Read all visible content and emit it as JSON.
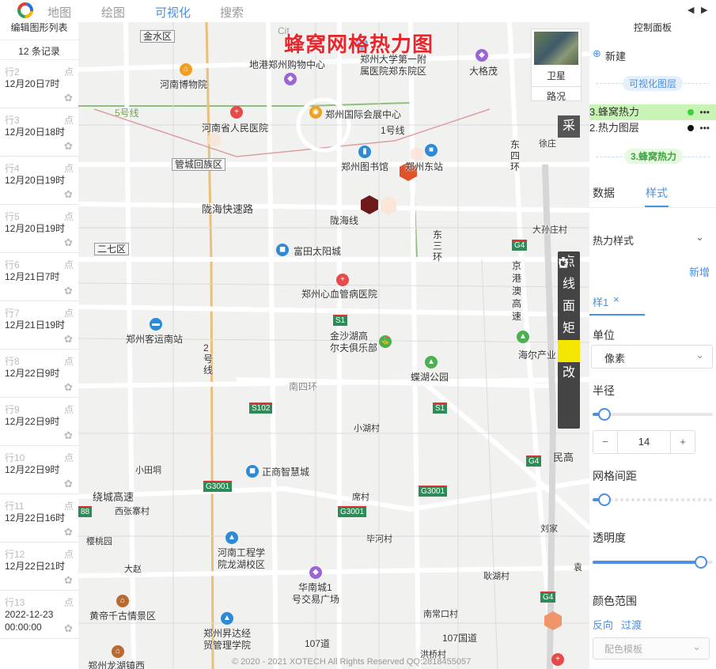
{
  "topbar": {
    "tabs": [
      {
        "label": "地图"
      },
      {
        "label": "绘图"
      },
      {
        "label": "可视化"
      },
      {
        "label": "搜索"
      }
    ]
  },
  "left": {
    "title": "编辑图形列表",
    "count": "12 条记录",
    "rows": [
      {
        "id": "行2",
        "point": "点",
        "time": "12月20日7时"
      },
      {
        "id": "行3",
        "point": "点",
        "time": "12月20日18时"
      },
      {
        "id": "行4",
        "point": "点",
        "time": "12月20日19时"
      },
      {
        "id": "行5",
        "point": "点",
        "time": "12月20日19时"
      },
      {
        "id": "行6",
        "point": "点",
        "time": "12月21日7时"
      },
      {
        "id": "行7",
        "point": "点",
        "time": "12月21日19时"
      },
      {
        "id": "行8",
        "point": "点",
        "time": "12月22日9时"
      },
      {
        "id": "行9",
        "point": "点",
        "time": "12月22日9时"
      },
      {
        "id": "行10",
        "point": "点",
        "time": "12月22日9时"
      },
      {
        "id": "行11",
        "point": "点",
        "time": "12月22日16时"
      },
      {
        "id": "行12",
        "point": "点",
        "time": "12月22日21时"
      },
      {
        "id": "行13",
        "point": "点",
        "time": "2022-12-23\n00:00:00"
      }
    ]
  },
  "map": {
    "title": "蜂窝网格热力图",
    "satellite_label": "卫星",
    "road_label": "路况",
    "cai_label": "采",
    "tools": [
      "点",
      "线",
      "面",
      "矩",
      "▤",
      "改",
      "🗑",
      "⏻"
    ],
    "copyright": "© 2020 - 2021 XOTECH All Rights Reserved QQ:2818455057",
    "labels": {
      "jinshui": "金水区",
      "dixun": "地港郑州购物中心",
      "henan_museum": "河南博物院",
      "zhengda": "郑州大学第一附",
      "zhengda2": "属医院郑东院区",
      "dageyu": "大格茂",
      "expo": "郑州国际会展中心",
      "hospital": "河南省人民医院",
      "library": "郑州图书馆",
      "east_station": "郑州东站",
      "guancheng": "管城回族区",
      "longhai": "陇海快速路",
      "longhai2": "陇海线",
      "erqi": "二七区",
      "futian": "富田太阳城",
      "heart": "郑州心血管病医院",
      "coach": "郑州客运南站",
      "golf": "金沙湖高",
      "golf2": "尔夫俱乐部",
      "dieshu": "蝶湖公园",
      "haier": "海尔产业",
      "xiaohu": "小湖村",
      "zhengshang": "正商智慧城",
      "xiaoyin": "小田垌",
      "xinan": "西张寨村",
      "raocheng": "绕城高速",
      "yingtao": "樱桃园",
      "henan_eng": "河南工程学",
      "henan_eng2": "院龙湖校区",
      "huanan": "华南城1",
      "huanan2": "号交易广场",
      "dazhao": "大赵",
      "huangdi": "黄帝千古情景区",
      "shengda": "郑州昇达经",
      "shengda2": "贸管理学院",
      "longhu": "郑州龙湖镇西",
      "xizhuang": "席村",
      "bihe": "毕河村",
      "nanchang": "南常口村",
      "hongqiao": "洪桥村",
      "dadahuang": "大孙庄村",
      "xulao": "徐庄",
      "liujia": "刘家",
      "ruiwang": "耿湖村",
      "yuan": "袁",
      "east4": "东四环",
      "east3": "东三环",
      "jinggang": "京港澳高速",
      "south4": "南四环",
      "line107": "107道",
      "line107b": "107国道",
      "line2": "2号线",
      "line1": "1号线",
      "line5": "5号线",
      "minggao": "民高",
      "cit": "Cit"
    },
    "shields": {
      "g4a": "G4",
      "g4b": "G4",
      "g4c": "G4",
      "s1a": "S1",
      "s1b": "S1",
      "s102": "S102",
      "g3001a": "G3001",
      "g3001b": "G3001",
      "g3001c": "G3001",
      "n88": "88"
    },
    "colors": {
      "hex_dark": "#6e1a1a",
      "hex_red": "#e2522a",
      "hex_orange": "#f0956a",
      "hex_pale": "#fbe3d6"
    }
  },
  "right": {
    "title": "控制面板",
    "new_label": "新建",
    "vis_layer_label": "可视化图层",
    "layers": [
      {
        "name": "3.蜂窝热力",
        "active": true
      },
      {
        "name": "2.热力图层",
        "active": false
      }
    ],
    "active_layer_pill": "3.蜂窝热力",
    "tab_data": "数据",
    "tab_style": "样式",
    "heat_style_label": "热力样式",
    "add_label": "新增",
    "style_tab": "样1",
    "unit_label": "单位",
    "unit_value": "像素",
    "radius_label": "半径",
    "radius_value": "14",
    "minus": "−",
    "plus": "+",
    "grid_label": "网格间距",
    "opacity_label": "透明度",
    "color_range_label": "颜色范围",
    "reverse_label": "反向",
    "transition_label": "过渡",
    "palette_placeholder": "配色模板",
    "radius_fraction": 0.05,
    "grid_fraction": 0.05,
    "opacity_fraction": 0.95
  }
}
